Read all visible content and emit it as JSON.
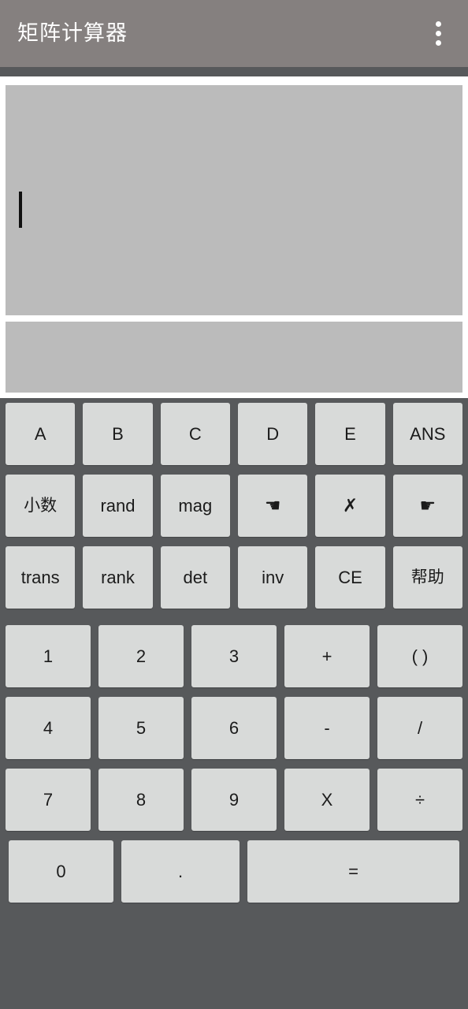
{
  "app": {
    "title": "矩阵计算器",
    "theme": {
      "titlebar_bg": "#85807f",
      "keypad_bg": "#57595b",
      "key_face": "#d8dad9",
      "display_bg": "#bbbbbb",
      "display_surround": "#ffffff",
      "key_text": "#1b1b1b",
      "title_text": "#ffffff"
    }
  },
  "titlebar": {
    "title": "矩阵计算器",
    "overflow_icon": "more-vert-icon"
  },
  "display": {
    "input_value": "",
    "input_placeholder": "",
    "result_value": "",
    "caret_visible": true
  },
  "keypad": {
    "rows": [
      {
        "name": "matrix-vars-row",
        "type": "function",
        "keys": [
          {
            "label": "A",
            "name": "key-a"
          },
          {
            "label": "B",
            "name": "key-b"
          },
          {
            "label": "C",
            "name": "key-c"
          },
          {
            "label": "D",
            "name": "key-d"
          },
          {
            "label": "E",
            "name": "key-e"
          },
          {
            "label": "ANS",
            "name": "key-ans"
          }
        ]
      },
      {
        "name": "ops-row-1",
        "type": "function",
        "keys": [
          {
            "label": "小数",
            "name": "key-decimal-mode"
          },
          {
            "label": "rand",
            "name": "key-rand"
          },
          {
            "label": "mag",
            "name": "key-mag"
          },
          {
            "label": "☚",
            "name": "key-cursor-left",
            "icon": "hand-pointing-left-icon"
          },
          {
            "label": "✗",
            "name": "key-delete",
            "icon": "cross-icon"
          },
          {
            "label": "☛",
            "name": "key-cursor-right",
            "icon": "hand-pointing-right-icon"
          }
        ]
      },
      {
        "name": "ops-row-2",
        "type": "function",
        "keys": [
          {
            "label": "trans",
            "name": "key-transpose"
          },
          {
            "label": "rank",
            "name": "key-rank"
          },
          {
            "label": "det",
            "name": "key-determinant"
          },
          {
            "label": "inv",
            "name": "key-inverse"
          },
          {
            "label": "CE",
            "name": "key-clear-entry"
          },
          {
            "label": "帮助",
            "name": "key-help"
          }
        ]
      },
      {
        "name": "numeric-row-1",
        "type": "numeric",
        "keys": [
          {
            "label": "1",
            "name": "key-1"
          },
          {
            "label": "2",
            "name": "key-2"
          },
          {
            "label": "3",
            "name": "key-3"
          },
          {
            "label": "+",
            "name": "key-plus"
          },
          {
            "label": "( )",
            "name": "key-parentheses"
          }
        ]
      },
      {
        "name": "numeric-row-2",
        "type": "numeric",
        "keys": [
          {
            "label": "4",
            "name": "key-4"
          },
          {
            "label": "5",
            "name": "key-5"
          },
          {
            "label": "6",
            "name": "key-6"
          },
          {
            "label": "-",
            "name": "key-minus"
          },
          {
            "label": "/",
            "name": "key-slash"
          }
        ]
      },
      {
        "name": "numeric-row-3",
        "type": "numeric",
        "keys": [
          {
            "label": "7",
            "name": "key-7"
          },
          {
            "label": "8",
            "name": "key-8"
          },
          {
            "label": "9",
            "name": "key-9"
          },
          {
            "label": "X",
            "name": "key-multiply"
          },
          {
            "label": "÷",
            "name": "key-divide"
          }
        ]
      }
    ],
    "bottom_row": {
      "name": "numeric-row-4",
      "keys": [
        {
          "label": "0",
          "name": "key-0",
          "width": "narrow"
        },
        {
          "label": ".",
          "name": "key-point",
          "width": "medium"
        },
        {
          "label": "=",
          "name": "key-equals",
          "width": "wide"
        }
      ]
    }
  }
}
